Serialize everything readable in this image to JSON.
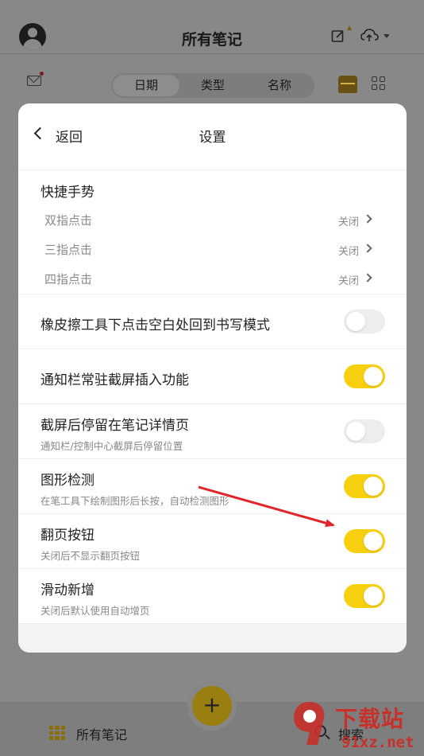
{
  "app": {
    "title": "所有笔记",
    "tabs": [
      {
        "label": "日期",
        "active": true
      },
      {
        "label": "类型",
        "active": false
      },
      {
        "label": "名称",
        "active": false
      }
    ],
    "bottom": {
      "notes_label": "所有笔记",
      "search_label": "搜索",
      "add_symbol": "+"
    },
    "icons": [
      "avatar-icon",
      "edit-icon",
      "cloud-upload-icon",
      "mail-icon",
      "treasure-chest-icon",
      "grid-view-icon"
    ]
  },
  "settings": {
    "back_label": "返回",
    "title": "设置",
    "gesture": {
      "title": "快捷手势",
      "rows": [
        {
          "label": "双指点击",
          "value": "关闭"
        },
        {
          "label": "三指点击",
          "value": "关闭"
        },
        {
          "label": "四指点击",
          "value": "关闭"
        }
      ]
    },
    "toggles": [
      {
        "title": "橡皮擦工具下点击空白处回到书写模式",
        "desc": "",
        "on": false
      },
      {
        "title": "通知栏常驻截屏插入功能",
        "desc": "",
        "on": true
      },
      {
        "title": "截屏后停留在笔记详情页",
        "desc": "通知栏/控制中心截屏后停留位置",
        "on": false
      },
      {
        "title": "图形检测",
        "desc": "在笔工具下绘制图形后长按，自动检测图形",
        "on": true
      },
      {
        "title": "翻页按钮",
        "desc": "关闭后不显示翻页按钮",
        "on": true
      },
      {
        "title": "滑动新增",
        "desc": "关闭后默认使用自动增页",
        "on": true
      }
    ]
  },
  "colors": {
    "accent": "#f6cf0f",
    "annotation_arrow": "#e0262a",
    "watermark": "#c8302a"
  },
  "watermark": {
    "text": "下载站",
    "url": "91xz.net"
  }
}
